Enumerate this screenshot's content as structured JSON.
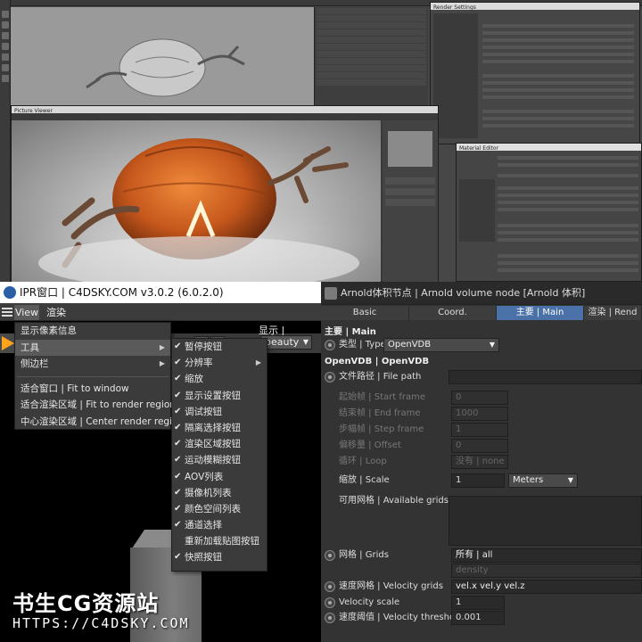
{
  "top_screenshot": {
    "picture_viewer_title": "Picture Viewer",
    "material_editor_title": "Material Editor",
    "render_settings_title": "Render Settings"
  },
  "ipr_window": {
    "title": "IPR窗口 | C4DSKY.COM v3.0.2 (6.0.2.0)",
    "menubar": {
      "view": "View",
      "render": "渲染"
    },
    "display_label": "显示 | Display",
    "aov_value": "beauty",
    "view_menu": {
      "items": [
        {
          "label": "显示像素信息",
          "submenu": false
        },
        {
          "label": "工具",
          "submenu": true,
          "highlighted": true
        },
        {
          "label": "侧边栏",
          "submenu": true
        },
        {
          "label": "适合窗口 | Fit to window",
          "submenu": false
        },
        {
          "label": "适合渲染区域 | Fit to render region",
          "submenu": false
        },
        {
          "label": "中心渲染区域 | Center render region",
          "submenu": false
        }
      ]
    },
    "tools_submenu": {
      "items": [
        {
          "label": "暂停按钮",
          "checked": true,
          "submenu": false
        },
        {
          "label": "分辨率",
          "checked": true,
          "submenu": true
        },
        {
          "label": "缩放",
          "checked": true,
          "submenu": false
        },
        {
          "label": "显示设置按钮",
          "checked": true,
          "submenu": false
        },
        {
          "label": "调试按钮",
          "checked": true,
          "submenu": false
        },
        {
          "label": "隔离选择按钮",
          "checked": true,
          "submenu": false
        },
        {
          "label": "渲染区域按钮",
          "checked": true,
          "submenu": false
        },
        {
          "label": "运动模糊按钮",
          "checked": true,
          "submenu": false
        },
        {
          "label": "AOV列表",
          "checked": true,
          "submenu": false
        },
        {
          "label": "摄像机列表",
          "checked": true,
          "submenu": false
        },
        {
          "label": "颜色空间列表",
          "checked": true,
          "submenu": false
        },
        {
          "label": "通道选择",
          "checked": true,
          "submenu": false
        },
        {
          "label": "重新加载贴图按钮",
          "checked": false,
          "submenu": false
        },
        {
          "label": "快照按钮",
          "checked": true,
          "submenu": false
        }
      ]
    }
  },
  "attributes": {
    "title": "Arnold体积节点 | Arnold volume node [Arnold 体积]",
    "tabs": [
      {
        "label": "Basic",
        "active": false
      },
      {
        "label": "Coord.",
        "active": false
      },
      {
        "label": "主要 | Main",
        "active": true
      },
      {
        "label": "渲染 | Rend",
        "active": false
      }
    ],
    "section_main": "主要 | Main",
    "type_label": "类型 | Type",
    "type_value": "OpenVDB",
    "section_openvdb": "OpenVDB | OpenVDB",
    "file_path_label": "文件路径 | File path",
    "start_frame_label": "起始帧 | Start frame",
    "start_frame_value": "0",
    "end_frame_label": "结束帧 | End frame",
    "end_frame_value": "1000",
    "step_frame_label": "步幅帧 | Step frame",
    "step_frame_value": "1",
    "offset_label": "偏移量 | Offset",
    "offset_value": "0",
    "loop_label": "循环 | Loop",
    "loop_value": "没有 | none",
    "scale_label": "缩放 | Scale",
    "scale_value": "1",
    "scale_unit": "Meters",
    "available_grids_label": "可用网格 | Available grids",
    "grids_label": "网格 | Grids",
    "grids_value": "所有 | all",
    "grids_hint": "density",
    "velocity_grids_label": "速度网格 | Velocity grids",
    "velocity_grids_value": "vel.x vel.y vel.z",
    "velocity_scale_label": "Velocity scale",
    "velocity_scale_value": "1",
    "velocity_threshold_label": "速度阈值 | Velocity threshold",
    "velocity_threshold_value": "0.001"
  },
  "watermark": {
    "line1": "书生CG资源站",
    "line2": "HTTPS://C4DSKY.COM"
  },
  "colors": {
    "accent_tab": "#4a72a8",
    "play_button": "#ffa21c"
  }
}
